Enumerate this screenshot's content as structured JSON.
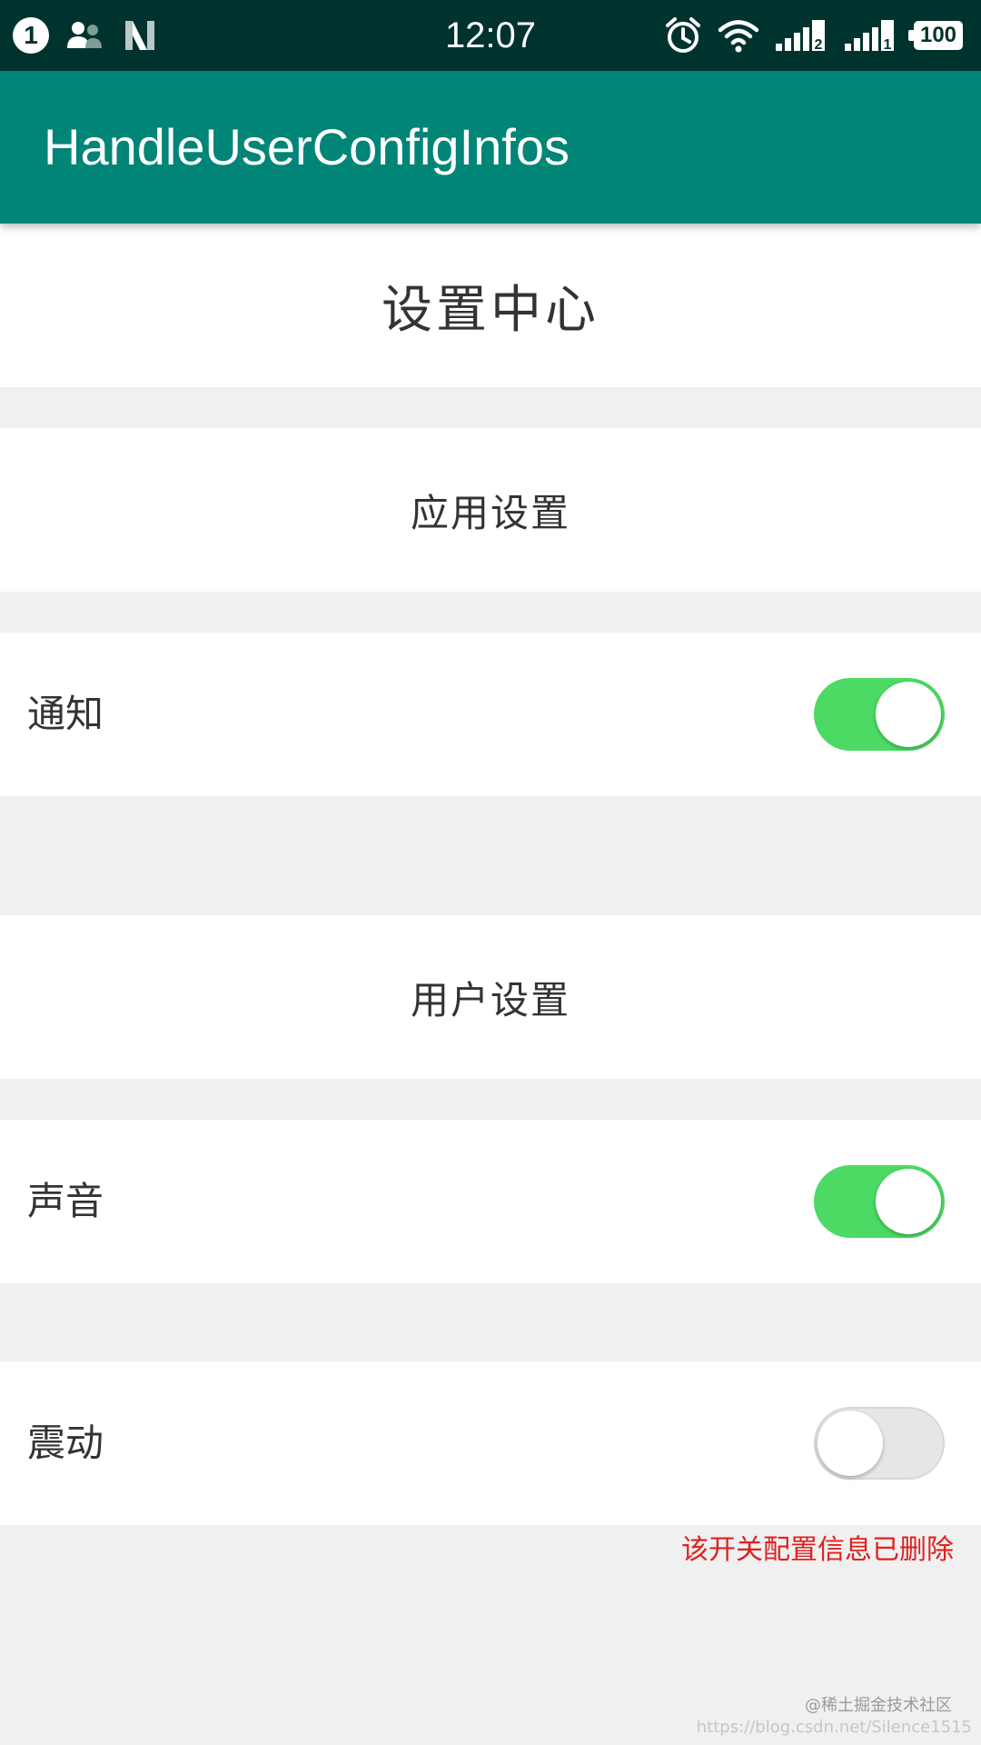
{
  "status_bar": {
    "notification_count": "1",
    "time": "12:07",
    "sim1_label": "2",
    "sim2_label": "1",
    "battery": "100",
    "icons": [
      "notification-count-icon",
      "contacts-icon",
      "n-logo-icon",
      "alarm-icon",
      "wifi-icon",
      "signal-icon",
      "signal-icon",
      "battery-icon"
    ]
  },
  "app_bar": {
    "title": "HandleUserConfigInfos",
    "color": "#008577"
  },
  "settings": {
    "page_title": "设置中心",
    "app_section": {
      "title": "应用设置",
      "notification": {
        "label": "通知",
        "enabled": true
      }
    },
    "user_section": {
      "title": "用户设置",
      "sound": {
        "label": "声音",
        "enabled": true
      },
      "vibration": {
        "label": "震动",
        "enabled": false
      }
    },
    "warning": "该开关配置信息已删除"
  },
  "watermark": {
    "line1": "@稀土掘金技术社区",
    "line2": "https://blog.csdn.net/Silence1515"
  },
  "colors": {
    "toggle_on": "#4cd964",
    "toggle_off": "#e6e6e6",
    "warning": "#e02020",
    "status_bar": "#00332d"
  }
}
